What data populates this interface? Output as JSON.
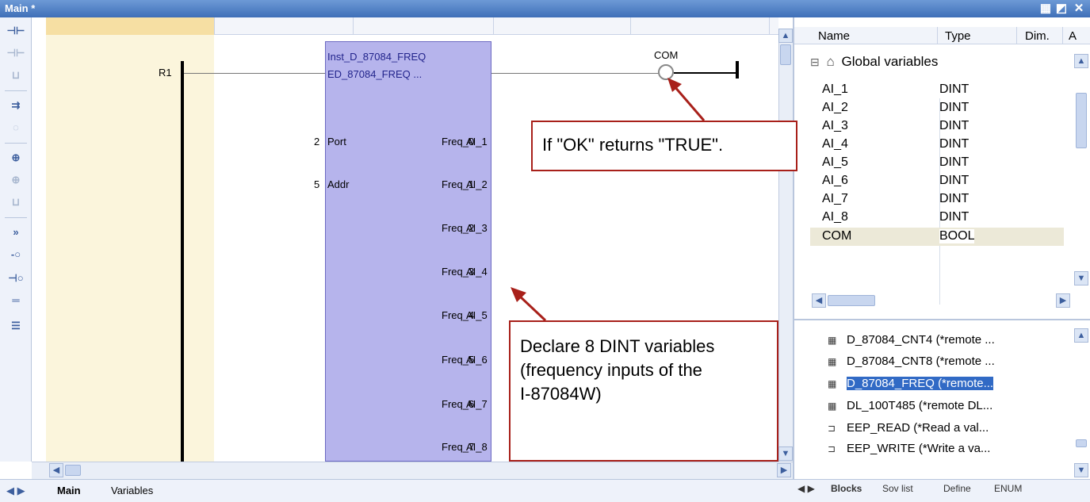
{
  "window": {
    "title": "Main *"
  },
  "ld": {
    "rung_label": "R1",
    "fb_instance": "Inst_D_87084_FREQ",
    "fb_type": "ED_87084_FREQ ...",
    "coil": "COM",
    "inputs": [
      {
        "value": "2",
        "pin": "Port"
      },
      {
        "value": "5",
        "pin": "Addr"
      }
    ],
    "outputs": [
      {
        "pin": "Freq_0",
        "var": "AI_1"
      },
      {
        "pin": "Freq_1",
        "var": "AI_2"
      },
      {
        "pin": "Freq_2",
        "var": "AI_3"
      },
      {
        "pin": "Freq_3",
        "var": "AI_4"
      },
      {
        "pin": "Freq_4",
        "var": "AI_5"
      },
      {
        "pin": "Freq_5",
        "var": "AI_6"
      },
      {
        "pin": "Freq_6",
        "var": "AI_7"
      },
      {
        "pin": "Freq_7",
        "var": "AI_8"
      }
    ]
  },
  "variables": {
    "headers": {
      "name": "Name",
      "type": "Type",
      "dim": "Dim.",
      "attr": "A"
    },
    "group": "Global variables",
    "rows": [
      {
        "name": "AI_1",
        "type": "DINT"
      },
      {
        "name": "AI_2",
        "type": "DINT"
      },
      {
        "name": "AI_3",
        "type": "DINT"
      },
      {
        "name": "AI_4",
        "type": "DINT"
      },
      {
        "name": "AI_5",
        "type": "DINT"
      },
      {
        "name": "AI_6",
        "type": "DINT"
      },
      {
        "name": "AI_7",
        "type": "DINT"
      },
      {
        "name": "AI_8",
        "type": "DINT"
      },
      {
        "name": "COM",
        "type": "BOOL"
      }
    ]
  },
  "blocks": {
    "items": [
      "D_87084_CNT4 (*remote ...",
      "D_87084_CNT8 (*remote ...",
      "D_87084_FREQ (*remote...",
      "DL_100T485 (*remote DL...",
      "EEP_READ (*Read a val...",
      "EEP_WRITE (*Write a va..."
    ],
    "tabs": [
      "Blocks",
      "Sov list",
      "Define",
      "ENUM"
    ]
  },
  "bottom_tabs": [
    "Main",
    "Variables"
  ],
  "callouts": {
    "ok": "If \"OK\" returns \"TRUE\".",
    "declare_line1": "Declare 8 DINT variables",
    "declare_line2": "(frequency inputs of the",
    "declare_line3": "I-87084W)"
  },
  "colors": {
    "fb_fill": "#b6b4ec",
    "callout_border": "#a8201a",
    "selection": "#316ac5"
  }
}
